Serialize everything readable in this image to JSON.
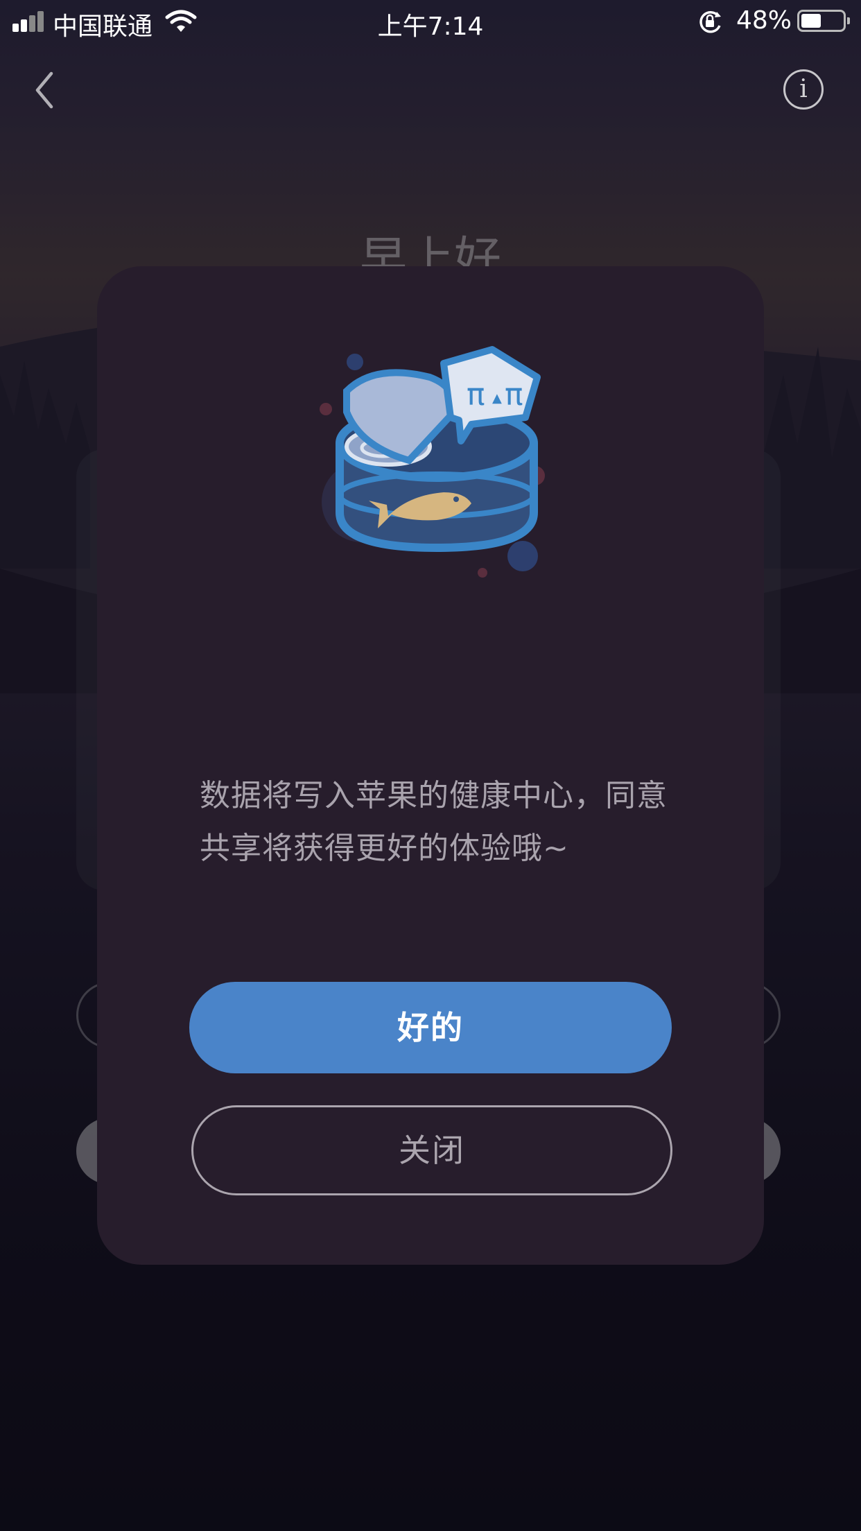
{
  "status_bar": {
    "carrier": "中国联通",
    "time": "上午7:14",
    "battery_percent": "48%",
    "battery_level": 0.48
  },
  "nav": {
    "back_icon": "chevron-left-icon",
    "info_icon": "info-icon",
    "info_glyph": "i"
  },
  "background": {
    "greeting": "早上好"
  },
  "dialog": {
    "illustration": "fish-can-icon",
    "message": "数据将写入苹果的健康中心，同意共享将获得更好的体验哦~",
    "confirm_label": "好的",
    "close_label": "关闭"
  },
  "colors": {
    "accent": "#4a84c9",
    "dialog_bg": "#271d2c",
    "message_text": "#a9a3ad"
  }
}
